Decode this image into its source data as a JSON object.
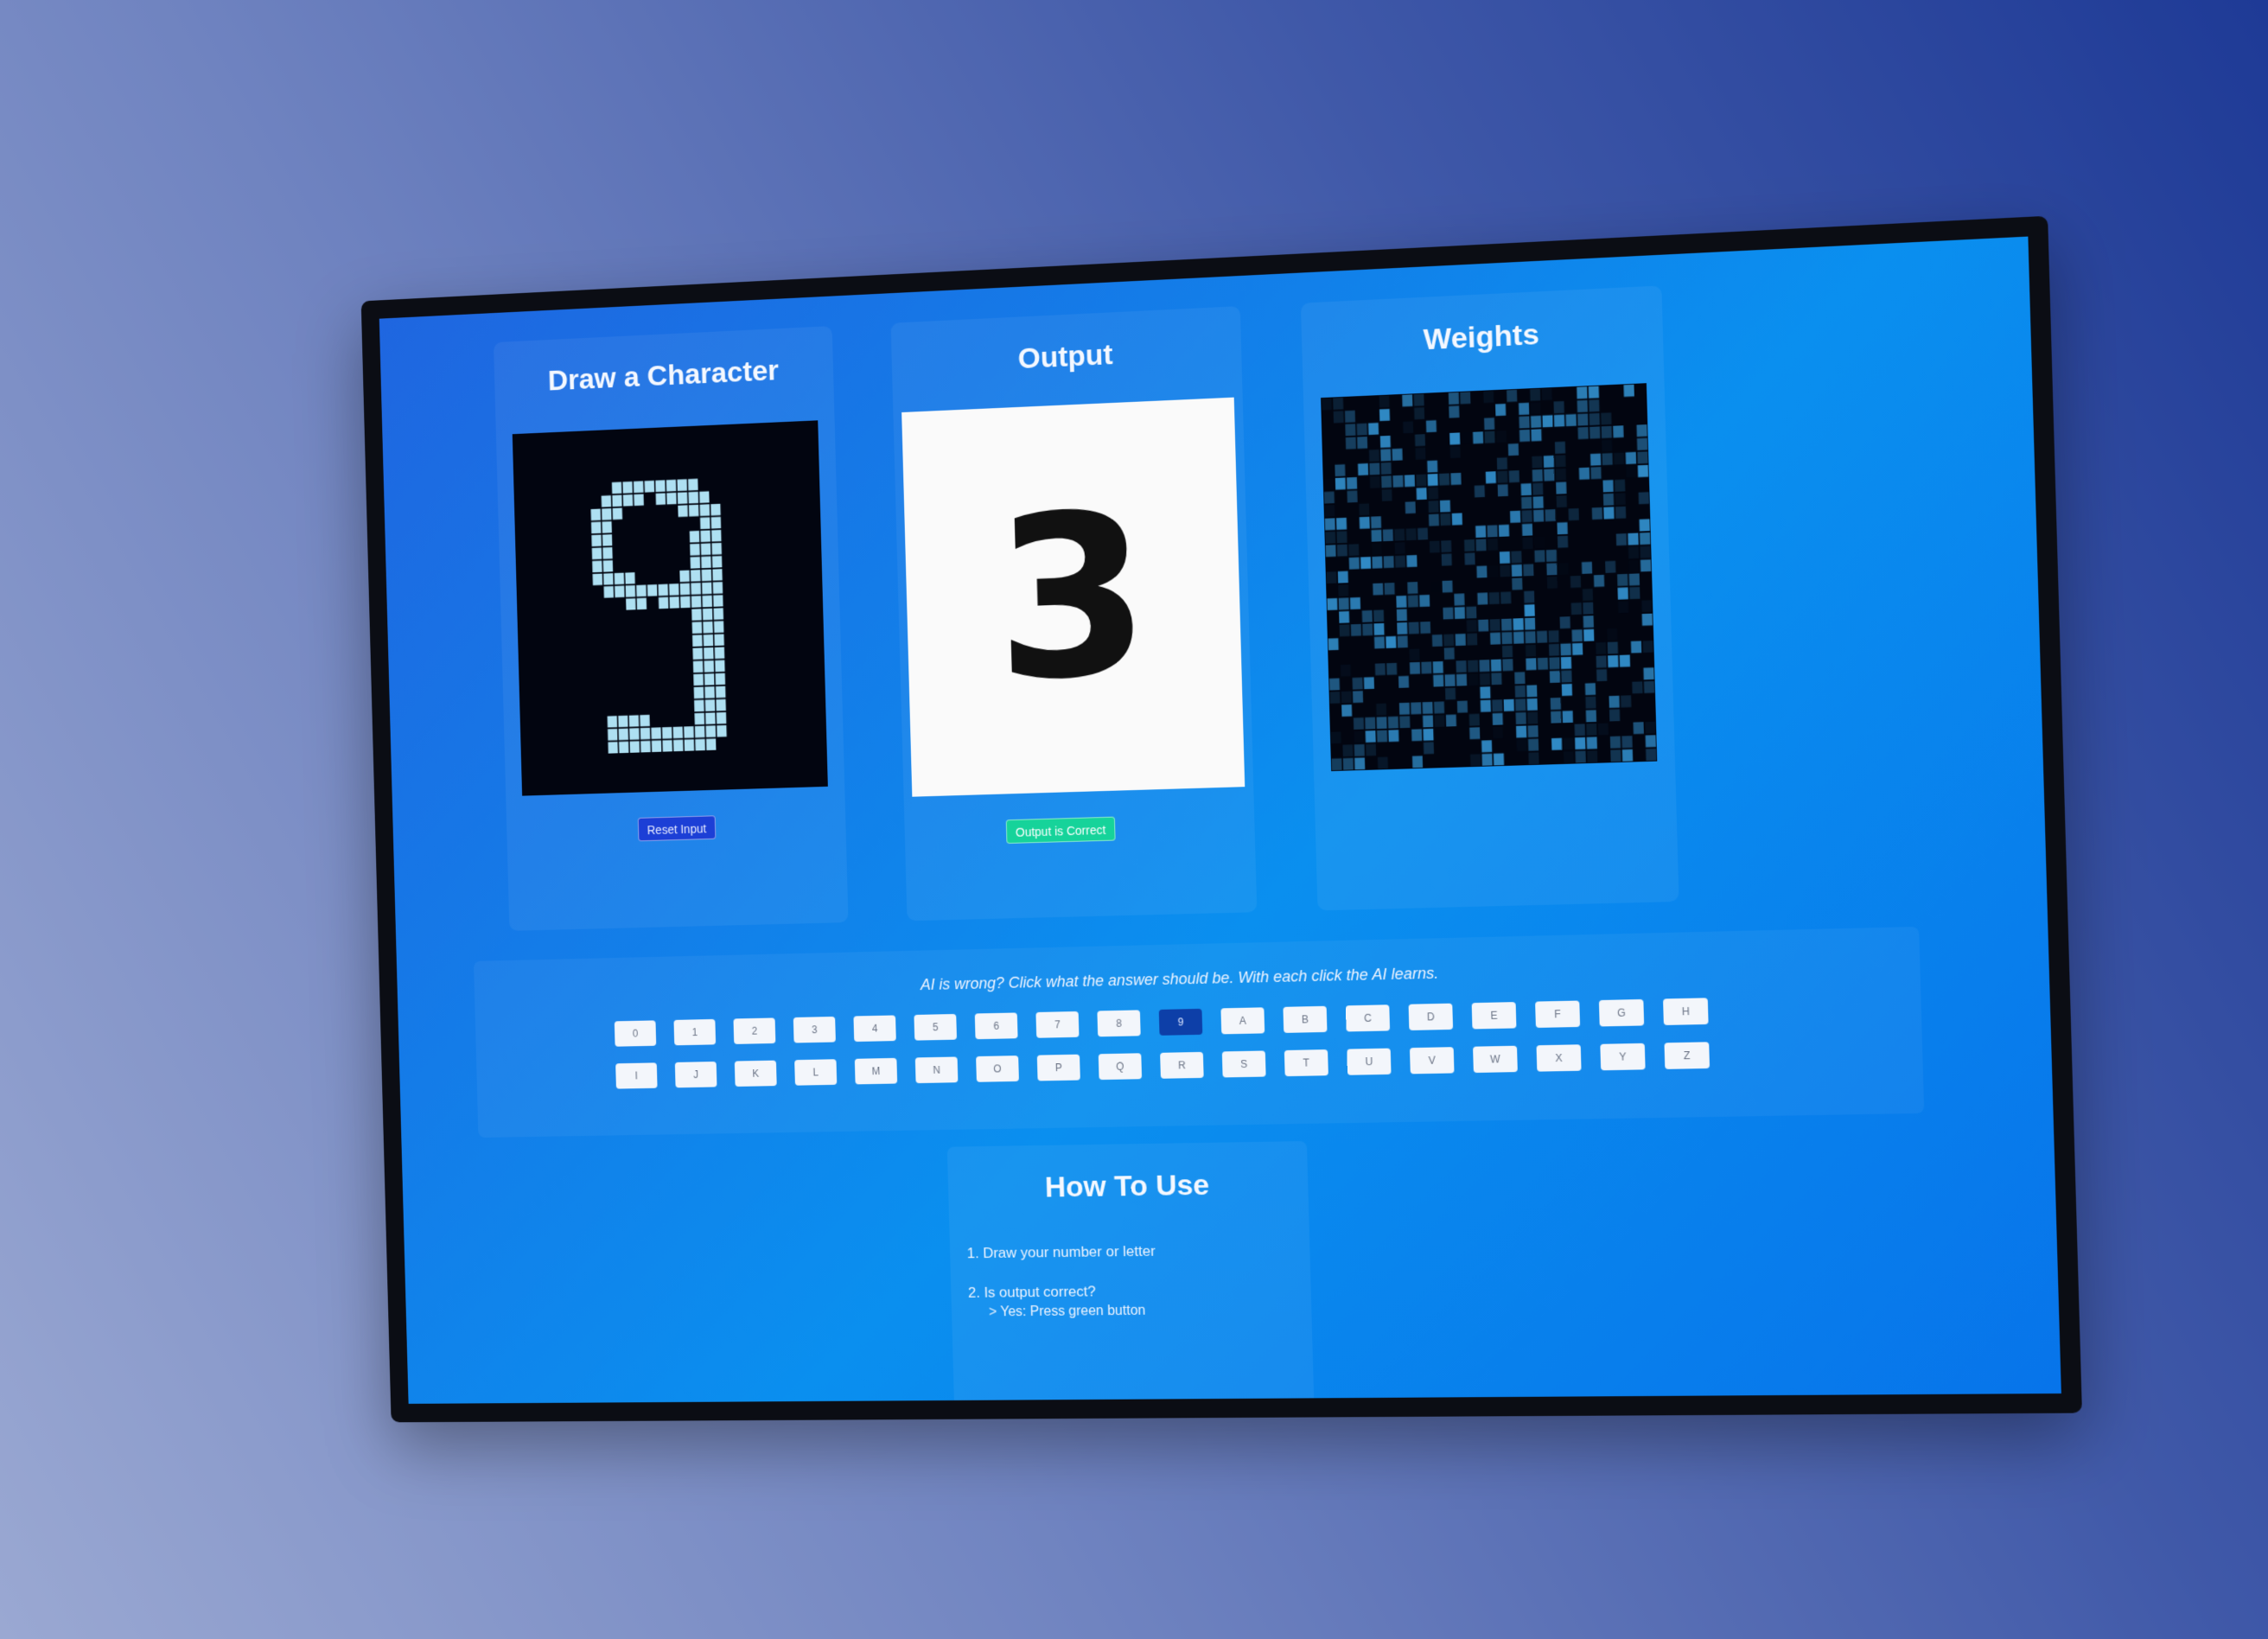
{
  "panels": {
    "draw": {
      "title": "Draw a Character",
      "reset_label": "Reset Input"
    },
    "output": {
      "title": "Output",
      "prediction": "3",
      "correct_label": "Output is Correct"
    },
    "weights": {
      "title": "Weights"
    }
  },
  "feedback": {
    "prompt": "AI is wrong? Click what the answer should be. With each click the AI learns.",
    "selected": "9",
    "row1": [
      "0",
      "1",
      "2",
      "3",
      "4",
      "5",
      "6",
      "7",
      "8",
      "9",
      "A",
      "B",
      "C",
      "D",
      "E",
      "F",
      "G",
      "H"
    ],
    "row2": [
      "I",
      "J",
      "K",
      "L",
      "M",
      "N",
      "O",
      "P",
      "Q",
      "R",
      "S",
      "T",
      "U",
      "V",
      "W",
      "X",
      "Y",
      "Z"
    ]
  },
  "howto": {
    "title": "How To Use",
    "step1": "1.  Draw your number or letter",
    "step2": "2.  Is output correct?",
    "step2_sub": "> Yes: Press green button"
  },
  "colors": {
    "screen_accent": "#0a8fef",
    "reset_button": "#1c3fd6",
    "correct_button": "#16d39a",
    "pixel_on": "#b7ecff"
  }
}
